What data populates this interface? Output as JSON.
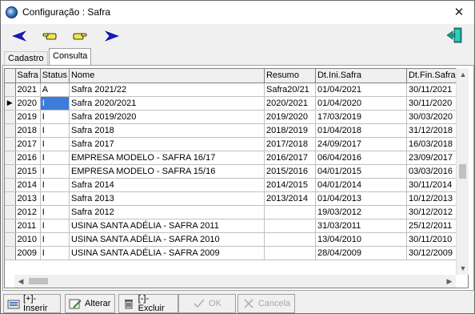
{
  "window": {
    "title": "Configuração : Safra",
    "close_glyph": "✕"
  },
  "toolbar": {
    "buttons": [
      {
        "name": "nav-prev-icon",
        "glyph": "◀",
        "color": "#1a1ac8"
      },
      {
        "name": "hand-point-left-icon",
        "glyph": "☚",
        "color": "#6b5a10"
      },
      {
        "name": "hand-point-right-icon",
        "glyph": "☛",
        "color": "#6b5a10"
      },
      {
        "name": "nav-next-icon",
        "glyph": "▶",
        "color": "#1a1ac8"
      }
    ],
    "exit_icon": "exit-door-icon"
  },
  "tabs": [
    {
      "label": "Cadastro",
      "active": false
    },
    {
      "label": "Consulta",
      "active": true
    }
  ],
  "grid": {
    "columns": [
      "Safra",
      "Status",
      "Nome",
      "Resumo",
      "Dt.Ini.Safra",
      "Dt.Fin.Safra"
    ],
    "current_row_indicator": "▶",
    "rows": [
      [
        "2021",
        "A",
        "Safra 2021/22",
        "Safra20/21",
        "01/04/2021",
        "30/11/2021"
      ],
      [
        "2020",
        "I",
        "Safra 2020/2021",
        "2020/2021",
        "01/04/2020",
        "30/11/2020"
      ],
      [
        "2019",
        "I",
        "Safra 2019/2020",
        "2019/2020",
        "17/03/2019",
        "30/03/2020"
      ],
      [
        "2018",
        "I",
        "Safra 2018",
        "2018/2019",
        "01/04/2018",
        "31/12/2018"
      ],
      [
        "2017",
        "I",
        "Safra 2017",
        "2017/2018",
        "24/09/2017",
        "16/03/2018"
      ],
      [
        "2016",
        "I",
        "EMPRESA MODELO - SAFRA 16/17",
        "2016/2017",
        "06/04/2016",
        "23/09/2017"
      ],
      [
        "2015",
        "I",
        "EMPRESA MODELO - SAFRA 15/16",
        "2015/2016",
        "04/01/2015",
        "03/03/2016"
      ],
      [
        "2014",
        "I",
        "Safra 2014",
        "2014/2015",
        "04/01/2014",
        "30/11/2014"
      ],
      [
        "2013",
        "I",
        "Safra 2013",
        "2013/2014",
        "01/04/2013",
        "10/12/2013"
      ],
      [
        "2012",
        "I",
        "Safra 2012",
        "",
        "19/03/2012",
        "30/12/2012"
      ],
      [
        "2011",
        "I",
        "USINA SANTA ADÉLIA - SAFRA 2011",
        "",
        "31/03/2011",
        "25/12/2011"
      ],
      [
        "2010",
        "I",
        "USINA SANTA ADÉLIA - SAFRA 2010",
        "",
        "13/04/2010",
        "30/11/2010"
      ],
      [
        "2009",
        "I",
        "USINA SANTA ADÉLIA - SAFRA 2009",
        "",
        "28/04/2009",
        "30/12/2009"
      ]
    ]
  },
  "buttons": {
    "insert": "[+]-Inserir",
    "edit": "Alterar",
    "delete": "[-]-Excluir",
    "ok": "OK",
    "cancel": "Cancela"
  },
  "colors": {
    "selection": "#3b7dd8"
  }
}
